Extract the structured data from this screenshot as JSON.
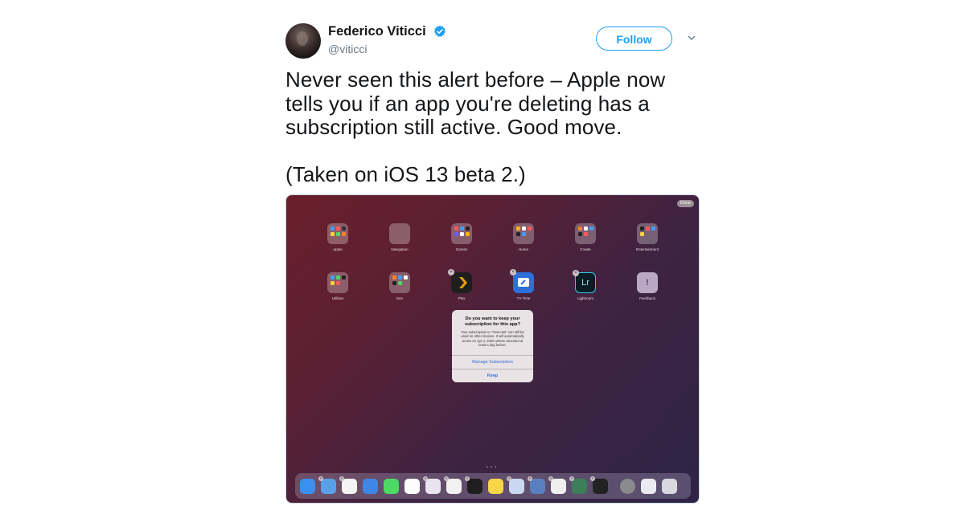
{
  "author": {
    "name": "Federico Viticci",
    "handle": "@viticci",
    "verified": true
  },
  "follow_label": "Follow",
  "tweet_text": {
    "line1": "Never seen this alert before – Apple now tells you if an app you're deleting has a subscription still active. Good move.",
    "line2": "(Taken on iOS 13 beta 2.)"
  },
  "ipad": {
    "done_label": "Done",
    "row1": [
      {
        "label": "Apple",
        "icon": "folder-icon"
      },
      {
        "label": "Navigation",
        "icon": "folder-icon"
      },
      {
        "label": "Games",
        "icon": "folder-icon"
      },
      {
        "label": "Home",
        "icon": "folder-icon"
      },
      {
        "label": "Create",
        "icon": "folder-icon"
      },
      {
        "label": "Entertainment",
        "icon": "folder-icon"
      }
    ],
    "row2": [
      {
        "label": "Utilities",
        "icon": "folder-icon"
      },
      {
        "label": "Dev",
        "icon": "folder-icon"
      },
      {
        "label": "Plex",
        "icon": "plex-icon"
      },
      {
        "label": "TV Time",
        "icon": "tv-time-icon"
      },
      {
        "label": "Lightroom",
        "icon": "lightroom-icon",
        "glyph": "Lr"
      },
      {
        "label": "Feedback",
        "icon": "feedback-icon",
        "glyph": "!"
      }
    ],
    "alert": {
      "title": "Do you want to keep your subscription for this app?",
      "message": "Your subscription to \"Overcast\" can still be used on other devices. It will automatically renew on Apr 3, 2020 unless canceled at least a day before.",
      "manage_label": "Manage Subscription",
      "keep_label": "Keep"
    },
    "page_dots": "• • •"
  },
  "colors": {
    "accent": "#1da1f2",
    "verified": "#1da1f2",
    "alert_button": "#2e6fd6"
  }
}
